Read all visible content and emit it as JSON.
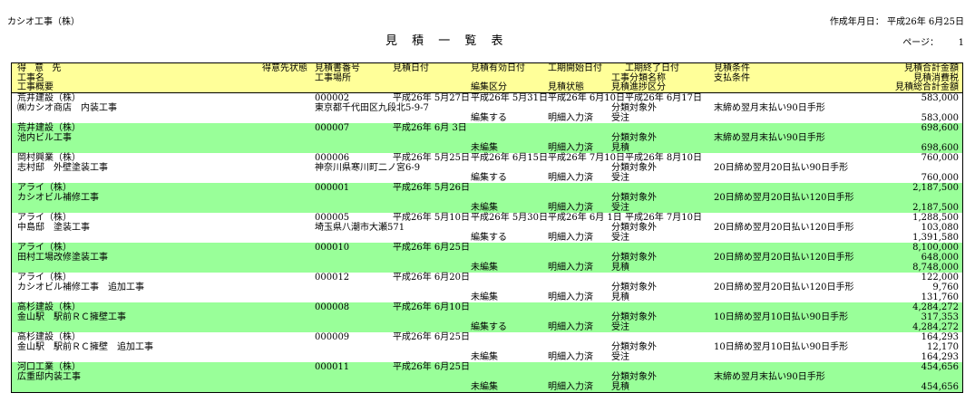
{
  "company": "カシオ工事（株）",
  "title": "見 積 一 覧 表",
  "created_label": "作成年月日：",
  "created_date": "平成26年 6月25日",
  "page_label": "ページ：",
  "page_number": "1",
  "header": {
    "customer": "得 意 先",
    "work_name": "工事名",
    "work_summary": "工事概要",
    "customer_status": "得意先状態",
    "estimate_no": "見積書番号",
    "work_place": "工事場所",
    "estimate_date": "見積日付",
    "valid_date": "見積有効日付",
    "edit_class": "編集区分",
    "start_date": "工期開始日付",
    "estimate_status": "見積状態",
    "end_date": "工期終了日付",
    "category_name": "工事分類名称",
    "progress_class": "見積進捗区分",
    "condition": "見積条件",
    "payment": "支払条件",
    "total": "見積合計金額",
    "tax": "見積消費税",
    "grand_total": "見積総合計金額"
  },
  "rows": [
    {
      "customer": "荒井建設（株）",
      "work_name": "㈱カシオ商店　内装工事",
      "estimate_no": "000002",
      "work_place": "東京都千代田区九段北5-9-7",
      "estimate_date": "平成26年 5月27日",
      "valid_date": "平成26年 5月31日",
      "start_date": "平成26年 6月10日",
      "end_date": "平成26年 6月17日",
      "category_name": "分類対象外",
      "edit_class": "編集する",
      "estimate_status": "明細入力済",
      "progress_class": "受注",
      "payment": "末締め翌月末払い90日手形",
      "total": "583,000",
      "tax": "",
      "grand_total": "583,000"
    },
    {
      "customer": "荒井建設（株）",
      "work_name": "池内ビル工事",
      "estimate_no": "000007",
      "work_place": "",
      "estimate_date": "平成26年 6月 3日",
      "valid_date": "",
      "start_date": "",
      "end_date": "",
      "category_name": "分類対象外",
      "edit_class": "未編集",
      "estimate_status": "明細入力済",
      "progress_class": "見積",
      "payment": "末締め翌月末払い90日手形",
      "total": "698,600",
      "tax": "",
      "grand_total": "698,600"
    },
    {
      "customer": "岡村興業（株）",
      "work_name": "志村邸　外壁塗装工事",
      "estimate_no": "000006",
      "work_place": "神奈川県寒川町二ノ宮6-9",
      "estimate_date": "平成26年 5月25日",
      "valid_date": "平成26年 6月15日",
      "start_date": "平成26年 7月10日",
      "end_date": "平成26年 8月10日",
      "category_name": "分類対象外",
      "edit_class": "編集する",
      "estimate_status": "明細入力済",
      "progress_class": "受注",
      "payment": "20日締め翌月20日払い90日手形",
      "total": "760,000",
      "tax": "",
      "grand_total": "760,000"
    },
    {
      "customer": "アライ（株）",
      "work_name": "カシオビル補修工事",
      "estimate_no": "000001",
      "work_place": "",
      "estimate_date": "平成26年 5月26日",
      "valid_date": "",
      "start_date": "",
      "end_date": "",
      "category_name": "分類対象外",
      "edit_class": "未編集",
      "estimate_status": "明細入力済",
      "progress_class": "受注",
      "payment": "20日締め翌月20日払い120日手形",
      "total": "2,187,500",
      "tax": "",
      "grand_total": "2,187,500"
    },
    {
      "customer": "アライ（株）",
      "work_name": "中島邸　塗装工事",
      "estimate_no": "000005",
      "work_place": "埼玉県八潮市大瀬571",
      "estimate_date": "平成26年 5月10日",
      "valid_date": "平成26年 5月30日",
      "start_date": "平成26年 6月 1日",
      "end_date": "平成26年 7月10日",
      "category_name": "分類対象外",
      "edit_class": "編集する",
      "estimate_status": "明細入力済",
      "progress_class": "受注",
      "payment": "20日締め翌月20日払い120日手形",
      "total": "1,288,500",
      "tax": "103,080",
      "grand_total": "1,391,580"
    },
    {
      "customer": "アライ（株）",
      "work_name": "田村工場改修塗装工事",
      "estimate_no": "000010",
      "work_place": "",
      "estimate_date": "平成26年 6月25日",
      "valid_date": "",
      "start_date": "",
      "end_date": "",
      "category_name": "分類対象外",
      "edit_class": "未編集",
      "estimate_status": "明細入力済",
      "progress_class": "見積",
      "payment": "20日締め翌月20日払い120日手形",
      "total": "8,100,000",
      "tax": "648,000",
      "grand_total": "8,748,000"
    },
    {
      "customer": "アライ（株）",
      "work_name": "カシオビル補修工事　追加工事",
      "estimate_no": "000012",
      "work_place": "",
      "estimate_date": "平成26年 6月20日",
      "valid_date": "",
      "start_date": "",
      "end_date": "",
      "category_name": "分類対象外",
      "edit_class": "未編集",
      "estimate_status": "明細入力済",
      "progress_class": "見積",
      "payment": "20日締め翌月20日払い120日手形",
      "total": "122,000",
      "tax": "9,760",
      "grand_total": "131,760"
    },
    {
      "customer": "高杉建設（株）",
      "work_name": "金山駅　駅前ＲＣ擁壁工事",
      "estimate_no": "000008",
      "work_place": "",
      "estimate_date": "平成26年 6月10日",
      "valid_date": "",
      "start_date": "",
      "end_date": "",
      "category_name": "分類対象外",
      "edit_class": "編集する",
      "estimate_status": "明細入力済",
      "progress_class": "受注",
      "payment": "10日締め翌月10日払い90日手形",
      "total": "4,284,272",
      "tax": "317,353",
      "grand_total": "4,284,272"
    },
    {
      "customer": "高杉建設（株）",
      "work_name": "金山駅　駅前ＲＣ擁壁　追加工事",
      "estimate_no": "000009",
      "work_place": "",
      "estimate_date": "平成26年 6月25日",
      "valid_date": "",
      "start_date": "",
      "end_date": "",
      "category_name": "分類対象外",
      "edit_class": "未編集",
      "estimate_status": "明細入力済",
      "progress_class": "受注",
      "payment": "10日締め翌月10日払い90日手形",
      "total": "164,293",
      "tax": "12,170",
      "grand_total": "164,293"
    },
    {
      "customer": "河口工業（株）",
      "work_name": "広重邸内装工事",
      "estimate_no": "000011",
      "work_place": "",
      "estimate_date": "平成26年 6月25日",
      "valid_date": "",
      "start_date": "",
      "end_date": "",
      "category_name": "分類対象外",
      "edit_class": "未編集",
      "estimate_status": "明細入力済",
      "progress_class": "見積",
      "payment": "末締め翌月末払い90日手形",
      "total": "454,656",
      "tax": "",
      "grand_total": "454,656"
    }
  ],
  "colors": {
    "header_bg": "#ffff99",
    "row_highlight": "#99ff99",
    "row_plain": "#ffffff"
  }
}
